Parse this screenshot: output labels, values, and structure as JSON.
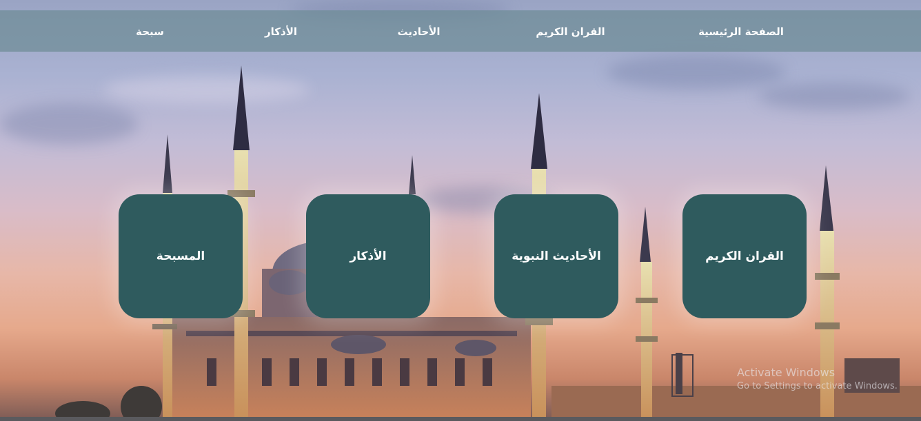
{
  "nav": {
    "items": [
      {
        "label": "الصفحة الرئيسية"
      },
      {
        "label": "القران الكريم"
      },
      {
        "label": "الأحاديث"
      },
      {
        "label": "الأذكار"
      },
      {
        "label": "سبحة"
      }
    ]
  },
  "cards": [
    {
      "label": "القران الكريم"
    },
    {
      "label": "الأحاديث النبوية"
    },
    {
      "label": "الأذكار"
    },
    {
      "label": "المسبحة"
    }
  ],
  "watermark": {
    "title": "Activate Windows",
    "subtitle": "Go to Settings to activate Windows."
  },
  "colors": {
    "card_bg": "#2f5b5e",
    "nav_bg": "#6e8c96",
    "text": "#ffffff"
  }
}
